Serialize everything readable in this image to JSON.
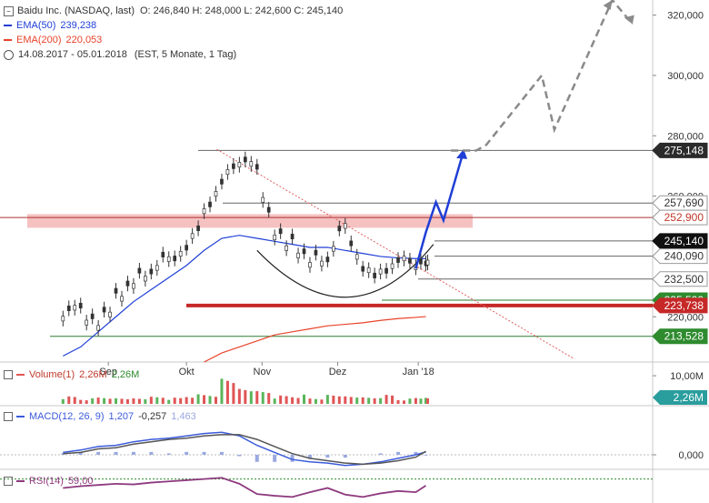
{
  "header": {
    "title": "Baidu Inc. (NASDAQ, last)",
    "ohlc": "O: 246,840  H: 248,000  L: 242,600  C: 245,140",
    "ema50_label": "EMA(50)",
    "ema50_value": "239,238",
    "ema200_label": "EMA(200)",
    "ema200_value": "220,053",
    "range": "14.08.2017 - 05.01.2018",
    "range_note": "(EST, 5 Monate, 1 Tag)"
  },
  "colors": {
    "ema50": "#1f3fd6",
    "ema200": "#e8432a",
    "up": "#2e7d32",
    "down": "#c62828",
    "forecast_blue": "#1f3fd6",
    "forecast_gray": "#8a8a8a",
    "resistance_zone": "#f3b6b6",
    "support_red": "#c62828",
    "volume_red": "#e05555",
    "volume_green": "#5bb55b",
    "label_dark": "#2b2b2b",
    "label_red": "#c0392b",
    "label_green": "#2e8b2e"
  },
  "chart_data": [
    {
      "type": "line",
      "title": "Baidu Inc. (NASDAQ, last)",
      "x_ticks": [
        "Sep",
        "Okt",
        "Nov",
        "Dez",
        "Jan '18"
      ],
      "y_ticks": [
        "220,000",
        "240,000",
        "260,000",
        "280,000",
        "300,000",
        "320,000"
      ],
      "ylim": [
        205,
        325
      ],
      "x": [
        "2017-08-14",
        "2017-08-21",
        "2017-08-28",
        "2017-09-04",
        "2017-09-11",
        "2017-09-18",
        "2017-09-25",
        "2017-10-02",
        "2017-10-09",
        "2017-10-16",
        "2017-10-23",
        "2017-10-30",
        "2017-11-06",
        "2017-11-13",
        "2017-11-20",
        "2017-11-27",
        "2017-12-04",
        "2017-12-11",
        "2017-12-18",
        "2017-12-25",
        "2018-01-01",
        "2018-01-05"
      ],
      "series": [
        {
          "name": "Baidu Inc. (NASDAQ, last)",
          "values": [
            222,
            218,
            226,
            231,
            236,
            239,
            243,
            254,
            264,
            273,
            268,
            248,
            244,
            238,
            240,
            250,
            236,
            234,
            238,
            239,
            236,
            245.14
          ]
        },
        {
          "name": "EMA(50)",
          "values": [
            207,
            210,
            215,
            220,
            225,
            229,
            233,
            237,
            242,
            246,
            247,
            246,
            245,
            244,
            243,
            243,
            242,
            241,
            240,
            239.5,
            239.3,
            239.238
          ]
        },
        {
          "name": "EMA(200)",
          "values": [
            null,
            null,
            null,
            null,
            null,
            null,
            null,
            null,
            205,
            208,
            210,
            212,
            214,
            215,
            216,
            217,
            217.5,
            218,
            218.8,
            219.4,
            219.8,
            220.053
          ]
        }
      ],
      "levels": [
        {
          "value": 275.148,
          "label": "275,148"
        },
        {
          "value": 257.69,
          "label": "257,690"
        },
        {
          "value": 252.9,
          "label": "252,900"
        },
        {
          "value": 245.14,
          "label": "245,140"
        },
        {
          "value": 240.09,
          "label": "240,090"
        },
        {
          "value": 232.5,
          "label": "232,500"
        },
        {
          "value": 225.5,
          "label": "225,500"
        },
        {
          "value": 223.738,
          "label": "223,738"
        },
        {
          "value": 213.528,
          "label": "213,528"
        }
      ],
      "forecast_blue": {
        "x": [
          "2018-01-01",
          "2018-01-05",
          "2018-01-09",
          "2018-01-12",
          "2018-01-20"
        ],
        "values": [
          236,
          248,
          258,
          252,
          275
        ]
      },
      "forecast_gray": {
        "x": [
          "2018-01-15",
          "2018-01-25",
          "2018-01-29",
          "2018-02-20",
          "2018-02-25",
          "2018-03-20",
          "2018-03-28"
        ],
        "values": [
          275.1,
          275.1,
          277,
          300,
          282,
          325,
          317
        ]
      }
    },
    {
      "type": "bar",
      "title": "Volume(1)",
      "value_label": "2,26M",
      "current_label": "2,26M",
      "y_ticks": [
        "10,00M"
      ],
      "values": [
        2.4,
        1.8,
        2.6,
        2.1,
        1.9,
        2.3,
        2.0,
        3.1,
        3.6,
        9.5,
        5.2,
        4.1,
        2.7,
        3.0,
        2.2,
        3.4,
        2.6,
        2.1,
        2.9,
        1.7,
        2.4,
        2.26
      ]
    },
    {
      "type": "line",
      "title": "MACD(12, 26, 9)",
      "value_labels": [
        "1,207",
        "-0,257",
        "1,463"
      ],
      "y_ticks": [
        "0,000"
      ],
      "series": [
        {
          "name": "MACD",
          "values": [
            1.0,
            2.0,
            3.5,
            4.0,
            5.5,
            6.5,
            7.0,
            8.0,
            9.0,
            9.5,
            8.0,
            4.0,
            1.0,
            -2.0,
            -3.0,
            -3.5,
            -4.5,
            -4.0,
            -3.0,
            -1.5,
            0.0,
            1.207
          ]
        },
        {
          "name": "Signal",
          "values": [
            0.5,
            1.0,
            2.5,
            3.0,
            4.5,
            5.5,
            6.5,
            7.0,
            8.0,
            8.5,
            8.5,
            6.5,
            3.5,
            0.5,
            -1.5,
            -2.5,
            -3.5,
            -4.0,
            -3.5,
            -2.5,
            -1.0,
            1.463
          ]
        }
      ]
    },
    {
      "type": "line",
      "title": "RSI(14)",
      "value_label": "59,00",
      "series": [
        {
          "name": "RSI(14)",
          "values": [
            55,
            58,
            60,
            62,
            61,
            64,
            66,
            68,
            70,
            72,
            62,
            45,
            42,
            40,
            48,
            55,
            44,
            40,
            46,
            50,
            48,
            59
          ]
        }
      ]
    }
  ]
}
